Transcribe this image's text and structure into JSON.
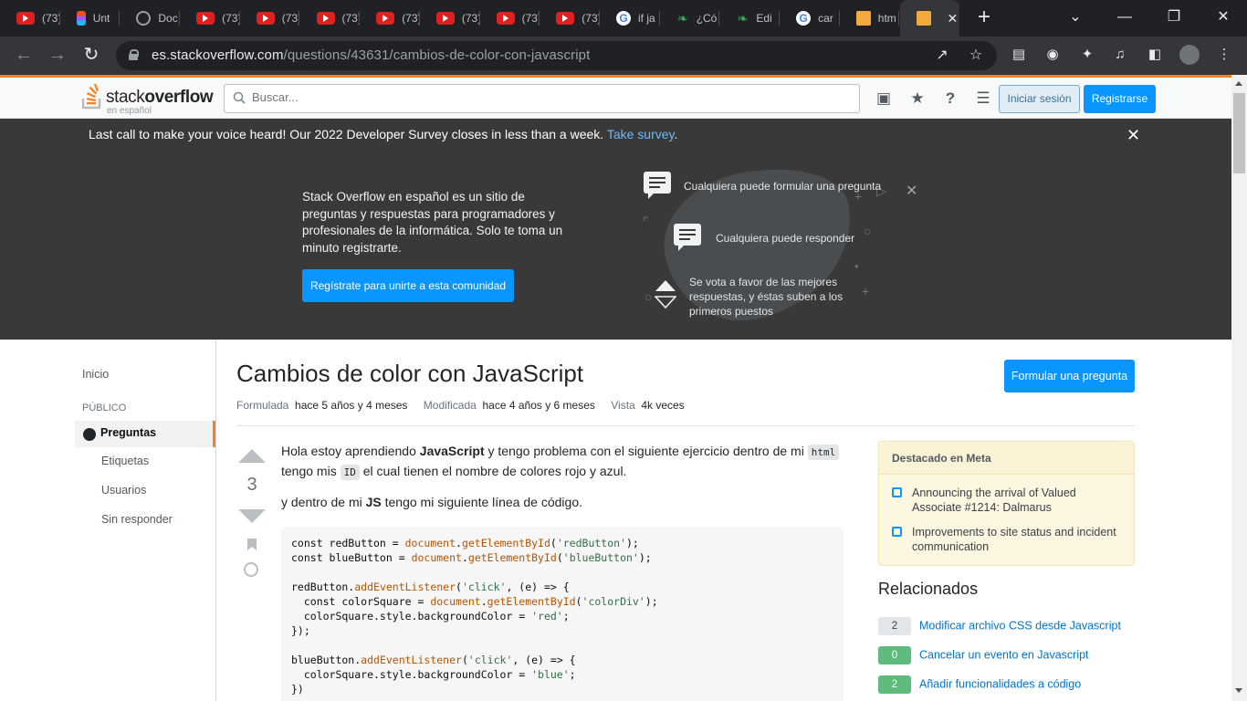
{
  "browser": {
    "tabs": [
      {
        "label": "(73)",
        "icon": "youtube-icon"
      },
      {
        "label": "Unt",
        "icon": "figma-icon"
      },
      {
        "label": "Doc",
        "icon": "globe-icon"
      },
      {
        "label": "(73)",
        "icon": "youtube-icon"
      },
      {
        "label": "(73)",
        "icon": "youtube-icon"
      },
      {
        "label": "(73)",
        "icon": "youtube-icon"
      },
      {
        "label": "(73)",
        "icon": "youtube-icon"
      },
      {
        "label": "(73)",
        "icon": "youtube-icon"
      },
      {
        "label": "(73)",
        "icon": "youtube-icon"
      },
      {
        "label": "(73)",
        "icon": "youtube-icon"
      },
      {
        "label": "if ja",
        "icon": "google-icon"
      },
      {
        "label": "¿Có",
        "icon": "leaf-icon"
      },
      {
        "label": "Edi",
        "icon": "leaf-icon"
      },
      {
        "label": "car",
        "icon": "google-icon"
      },
      {
        "label": "htm",
        "icon": "stackoverflow-icon"
      },
      {
        "label": "",
        "icon": "stackoverflow-icon",
        "active": true
      }
    ],
    "url_host": "es.stackoverflow.com",
    "url_path": "/questions/43631/cambios-de-color-con-javascript"
  },
  "header": {
    "logo_word_light": "stack",
    "logo_word_bold": "overflow",
    "logo_sub": "en español",
    "search_placeholder": "Buscar...",
    "login_label": "Iniciar sesión",
    "signup_label": "Registrarse"
  },
  "survey": {
    "text": "Last call to make your voice heard! Our 2022 Developer Survey closes in less than a week.",
    "link": "Take survey",
    "period": "."
  },
  "hero": {
    "intro": "Stack Overflow en español es un sitio de preguntas y respuestas para programadores y profesionales de la informática. Solo te toma un minuto registrarte.",
    "cta": "Regístrate para unirte a esta comunidad",
    "features": [
      "Cualquiera puede formular una pregunta",
      "Cualquiera puede responder",
      "Se vota a favor de las mejores respuestas, y éstas suben a los primeros puestos"
    ]
  },
  "leftnav": {
    "home": "Inicio",
    "public": "PÚBLICO",
    "questions": "Preguntas",
    "tags": "Etiquetas",
    "users": "Usuarios",
    "unanswered": "Sin responder"
  },
  "question": {
    "title": "Cambios de color con JavaScript",
    "ask_button": "Formular una pregunta",
    "asked_label": "Formulada",
    "asked_value": "hace 5 años y 4 meses",
    "modified_label": "Modificada",
    "modified_value": "hace 4 años y 6 meses",
    "viewed_label": "Vista",
    "viewed_value": "4k veces",
    "score": "3",
    "p1_a": "Hola estoy aprendiendo ",
    "p1_b": "JavaScript",
    "p1_c": " y tengo problema con el siguiente ejercicio dentro de mi ",
    "p1_code1": "html",
    "p1_d": " tengo mis ",
    "p1_code2": "ID",
    "p1_e": " el cual tienen el nombre de colores rojo y azul.",
    "p2_a": "y dentro de mi ",
    "p2_b": "JS",
    "p2_c": " tengo mi siguiente línea de código.",
    "code": [
      "const redButton = document.getElementById('redButton');",
      "const blueButton = document.getElementById('blueButton');",
      "",
      "redButton.addEventListener('click', (e) => {",
      "  const colorSquare = document.getElementById('colorDiv');",
      "  colorSquare.style.backgroundColor = 'red';",
      "});",
      "",
      "blueButton.addEventListener('click', (e) => {",
      "  colorSquare.style.backgroundColor = 'blue';",
      "})"
    ]
  },
  "sidebar": {
    "meta_title": "Destacado en Meta",
    "meta_items": [
      "Announcing the arrival of Valued Associate #1214: Dalmarus",
      "Improvements to site status and incident communication"
    ],
    "related_title": "Relacionados",
    "related": [
      {
        "count": "2",
        "title": "Modificar archivo CSS desde Javascript",
        "answered": false
      },
      {
        "count": "0",
        "title": "Cancelar un evento en Javascript",
        "answered": true
      },
      {
        "count": "2",
        "title": "Añadir funcionalidades a código",
        "answered": true
      }
    ]
  },
  "colors": {
    "accent": "#0a95ff",
    "brand": "#f48225",
    "dark": "#393939"
  }
}
